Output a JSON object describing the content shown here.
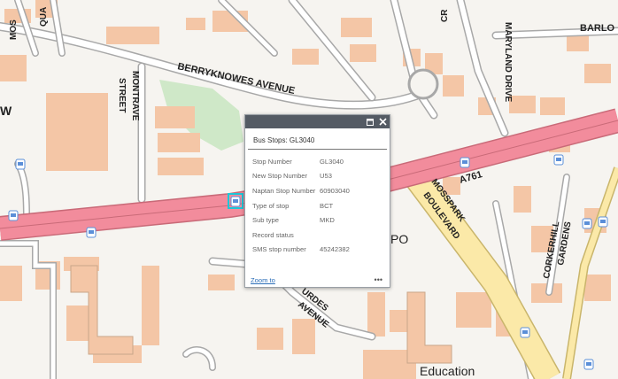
{
  "map": {
    "labels": {
      "berryknowes": "BERRYKNOWES AVENUE",
      "montrave": "MONTRAVE",
      "street": "STREET",
      "maryland": "MARYLAND DRIVE",
      "barlo": "BARLO",
      "a761": "A761",
      "mosspark": "MOSSPARK",
      "boulevard": "BOULEVARD",
      "corkerhill": "CORKERHILL",
      "gardens": "GARDENS",
      "lourdes": "URDES",
      "avenue2": "AVENUE",
      "education": "Education",
      "po": "PO",
      "w": "W",
      "mos": "MOS",
      "qua": "QUA",
      "cr": "CR"
    },
    "colors": {
      "road": "#f28c9c",
      "road_border": "#c96a78",
      "building": "#f4c6a6",
      "park": "#cfe8c8",
      "stop": "#5b8fd8"
    }
  },
  "popup": {
    "title": "Bus Stops: GL3040",
    "attributes": [
      {
        "label": "Stop Number",
        "value": "GL3040"
      },
      {
        "label": "New Stop Number",
        "value": "U53"
      },
      {
        "label": "Naptan Stop Number",
        "value": "60903040"
      },
      {
        "label": "Type of stop",
        "value": "BCT"
      },
      {
        "label": "Sub type",
        "value": "MKD"
      },
      {
        "label": "Record status",
        "value": ""
      },
      {
        "label": "SMS stop number",
        "value": "45242382"
      }
    ],
    "zoom_label": "Zoom to",
    "more_label": "•••",
    "icons": {
      "maximize": "maximize-icon",
      "close": "close-icon"
    }
  }
}
